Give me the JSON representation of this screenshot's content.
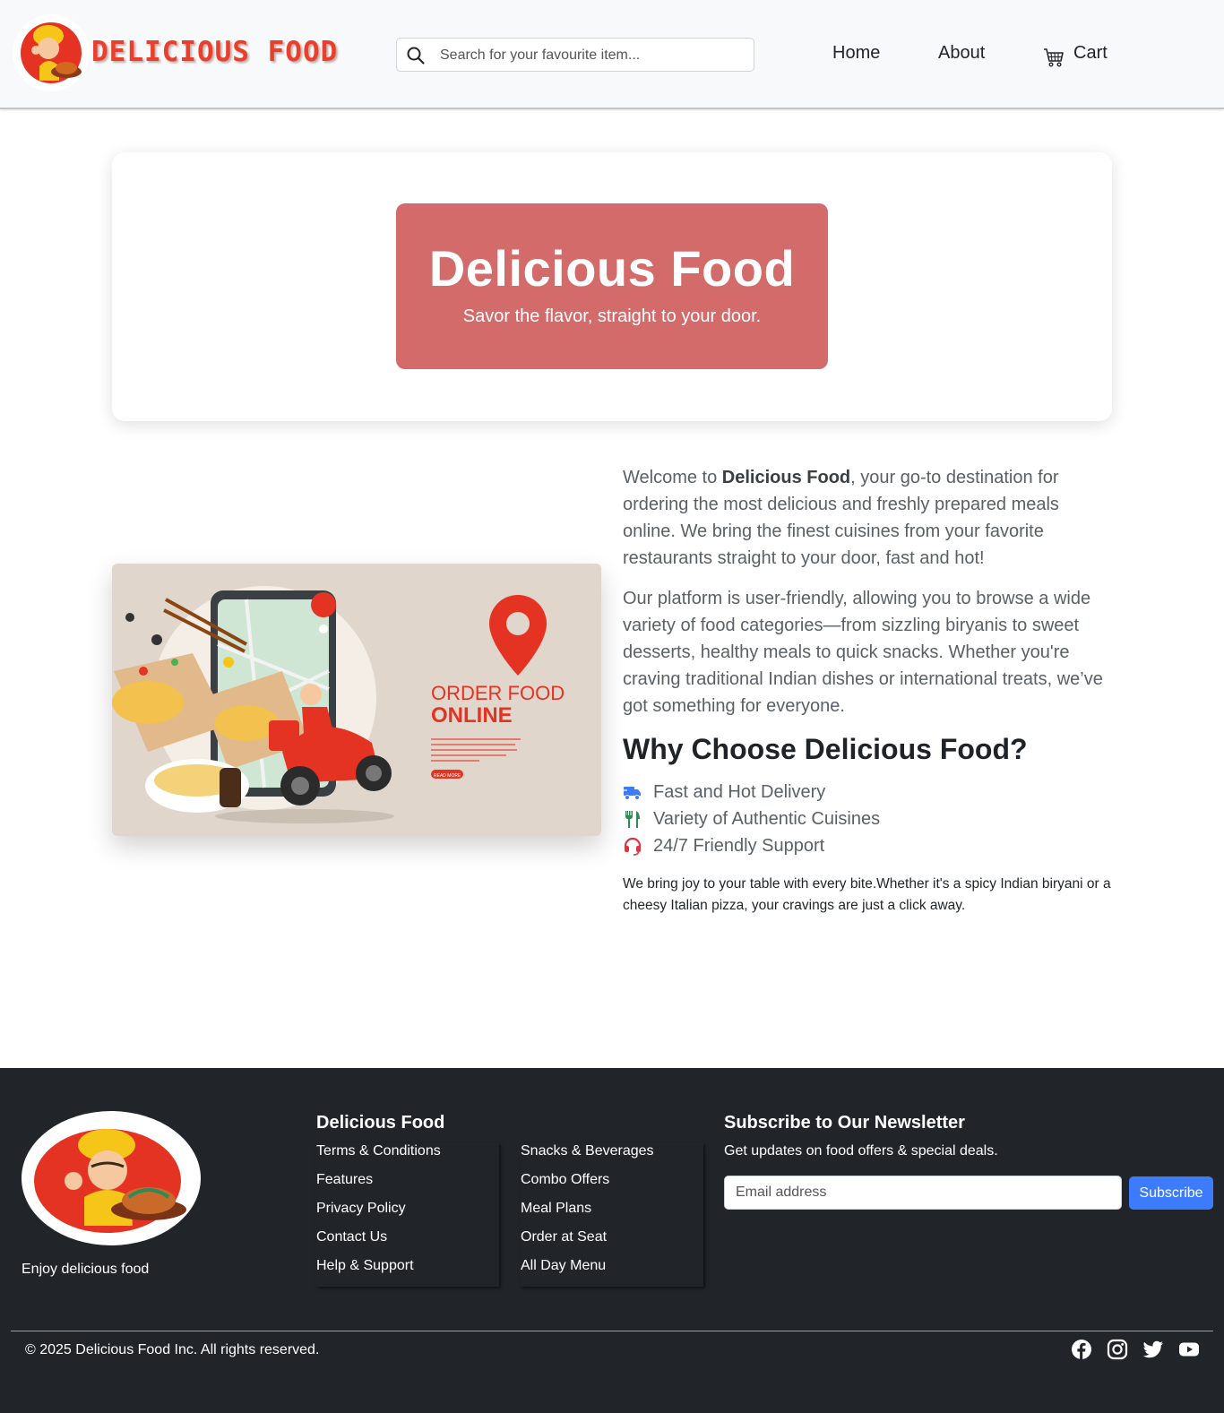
{
  "header": {
    "brand": "DELICIOUS FOOD",
    "search_placeholder": "Search for your favourite item...",
    "nav": {
      "home": "Home",
      "about": "About",
      "cart": "Cart"
    }
  },
  "hero": {
    "title": "Delicious Food",
    "subtitle": "Savor the flavor, straight to your door."
  },
  "illustration": {
    "heading_line1": "ORDER FOOD",
    "heading_line2": "ONLINE",
    "button": "READ MORE"
  },
  "about": {
    "p1_pre": "Welcome to ",
    "p1_bold": "Delicious Food",
    "p1_post": ", your go-to destination for ordering the most delicious and freshly prepared meals online. We bring the finest cuisines from your favorite restaurants straight to your door, fast and hot!",
    "p2": "Our platform is user-friendly, allowing you to browse a wide variety of food categories—from sizzling biryanis to sweet desserts, healthy meals to quick snacks. Whether you're craving traditional Indian dishes or international treats, we’ve got something for everyone.",
    "why_title": "Why Choose Delicious Food?",
    "features": [
      {
        "label": "Fast and Hot Delivery",
        "icon": "truck-icon",
        "color": "#3d7bfd"
      },
      {
        "label": "Variety of Authentic Cuisines",
        "icon": "utensils-icon",
        "color": "#2e8b57"
      },
      {
        "label": "24/7 Friendly Support",
        "icon": "headset-icon",
        "color": "#dc3545"
      }
    ],
    "closing": "We bring joy to your table with every bite.Whether it's a spicy Indian biryani or a cheesy Italian pizza, your cravings are just a click away."
  },
  "footer": {
    "tagline": "Enjoy delicious food",
    "col_title": "Delicious Food",
    "links_a": [
      "Terms & Conditions",
      "Features",
      "Privacy Policy",
      "Contact Us",
      "Help & Support"
    ],
    "links_b": [
      "Snacks & Beverages",
      "Combo Offers",
      "Meal Plans",
      "Order at Seat",
      "All Day Menu"
    ],
    "newsletter_title": "Subscribe to Our Newsletter",
    "newsletter_desc": "Get updates on food offers & special deals.",
    "email_placeholder": "Email address",
    "subscribe_label": "Subscribe",
    "copyright": "© 2025 Delicious Food Inc. All rights reserved.",
    "social": [
      "facebook-icon",
      "instagram-icon",
      "twitter-icon",
      "youtube-icon"
    ]
  },
  "colors": {
    "brand_red": "#e8402c",
    "hero_banner": "#d36b6b",
    "footer_bg": "#212529",
    "accent_blue": "#3d7bfd"
  }
}
